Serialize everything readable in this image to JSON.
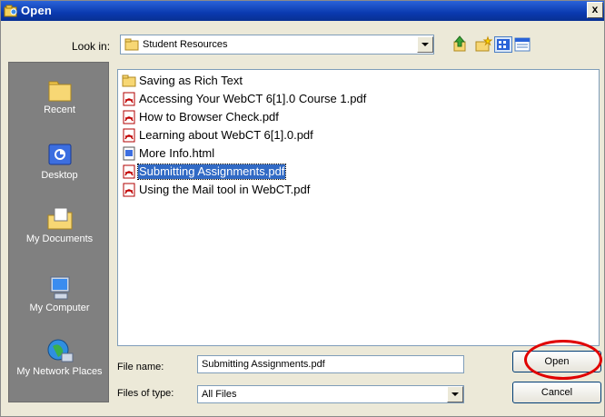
{
  "window": {
    "title": "Open",
    "close_glyph": "x"
  },
  "look_in": {
    "label": "Look in:",
    "value": "Student Resources",
    "icon": "folder-icon",
    "toolbar_icons": [
      "back-folder-icon",
      "new-folder-icon",
      "view-menu-icon",
      "details-view-icon"
    ]
  },
  "places": [
    {
      "label": "Recent",
      "icon": "recent-folder-icon"
    },
    {
      "label": "Desktop",
      "icon": "desktop-icon"
    },
    {
      "label": "My Documents",
      "icon": "my-documents-icon"
    },
    {
      "label": "My Computer",
      "icon": "my-computer-icon"
    },
    {
      "label": "My Network Places",
      "icon": "network-places-icon"
    }
  ],
  "files": [
    {
      "name": "Saving as Rich Text",
      "type": "folder"
    },
    {
      "name": "Accessing Your WebCT 6[1].0 Course 1.pdf",
      "type": "pdf"
    },
    {
      "name": "How to Browser Check.pdf",
      "type": "pdf"
    },
    {
      "name": "Learning about WebCT 6[1].0.pdf",
      "type": "pdf"
    },
    {
      "name": "More Info.html",
      "type": "html"
    },
    {
      "name": "Submitting Assignments.pdf",
      "type": "pdf",
      "selected": true
    },
    {
      "name": "Using the Mail tool in WebCT.pdf",
      "type": "pdf"
    }
  ],
  "file_name": {
    "label": "File name:",
    "value": "Submitting Assignments.pdf"
  },
  "file_type": {
    "label": "Files of type:",
    "value": "All Files"
  },
  "buttons": {
    "open": "Open",
    "cancel": "Cancel"
  },
  "colors": {
    "titlebar": "#0a3ab0",
    "selection": "#316ac5",
    "places_bg": "#808080",
    "highlight_circle": "#e00000"
  }
}
